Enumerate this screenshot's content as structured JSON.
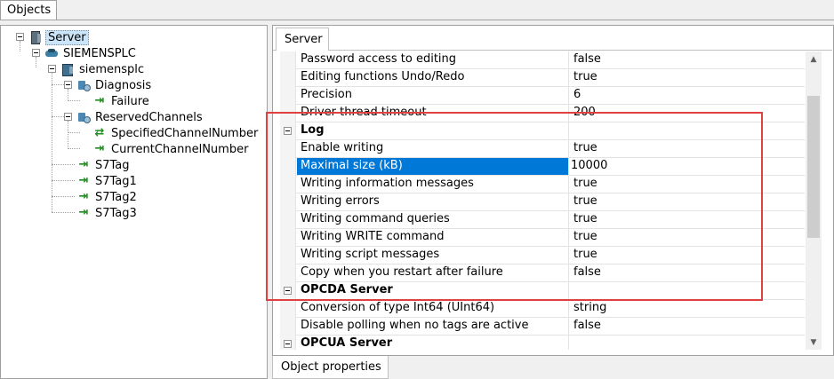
{
  "top_tab": {
    "label": "Objects"
  },
  "tree": {
    "nodes": [
      {
        "label": "Server",
        "icon": "server-icon"
      },
      {
        "label": "SIEMENSPLC",
        "icon": "plc-icon"
      },
      {
        "label": "siemensplc",
        "icon": "device-icon"
      },
      {
        "label": "Diagnosis",
        "icon": "folder-icon"
      },
      {
        "label": "Failure",
        "icon": "tag-arrow-icon"
      },
      {
        "label": "ReservedChannels",
        "icon": "folder-icon"
      },
      {
        "label": "SpecifiedChannelNumber",
        "icon": "tag-bidirectional-icon"
      },
      {
        "label": "CurrentChannelNumber",
        "icon": "tag-arrow-icon"
      },
      {
        "label": "S7Tag",
        "icon": "tag-arrow-icon"
      },
      {
        "label": "S7Tag1",
        "icon": "tag-arrow-icon"
      },
      {
        "label": "S7Tag2",
        "icon": "tag-arrow-icon"
      },
      {
        "label": "S7Tag3",
        "icon": "tag-arrow-icon"
      }
    ]
  },
  "right": {
    "tab_label": "Server",
    "bottom_tab_label": "Object properties",
    "rows": [
      {
        "name": "Password access to editing",
        "value": "false"
      },
      {
        "name": "Editing functions Undo/Redo",
        "value": "true"
      },
      {
        "name": "Precision",
        "value": "6"
      },
      {
        "name": "Driver thread timeout",
        "value": "200"
      },
      {
        "name": "Log",
        "value": ""
      },
      {
        "name": "Enable writing",
        "value": "true"
      },
      {
        "name": "Maximal size (kB)",
        "value": "10000"
      },
      {
        "name": "Writing information messages",
        "value": "true"
      },
      {
        "name": "Writing errors",
        "value": "true"
      },
      {
        "name": "Writing command queries",
        "value": "true"
      },
      {
        "name": "Writing WRITE command",
        "value": "true"
      },
      {
        "name": "Writing script messages",
        "value": "true"
      },
      {
        "name": "Copy when you restart after failure",
        "value": "false"
      },
      {
        "name": "OPCDA Server",
        "value": ""
      },
      {
        "name": "Conversion of type Int64 (UInt64)",
        "value": "string"
      },
      {
        "name": "Disable polling when no tags are active",
        "value": "false"
      },
      {
        "name": "OPCUA Server",
        "value": ""
      }
    ]
  },
  "colors": {
    "highlight": "#e04040",
    "selection": "#0078d7",
    "tag_arrow": "#1c8d1c"
  }
}
